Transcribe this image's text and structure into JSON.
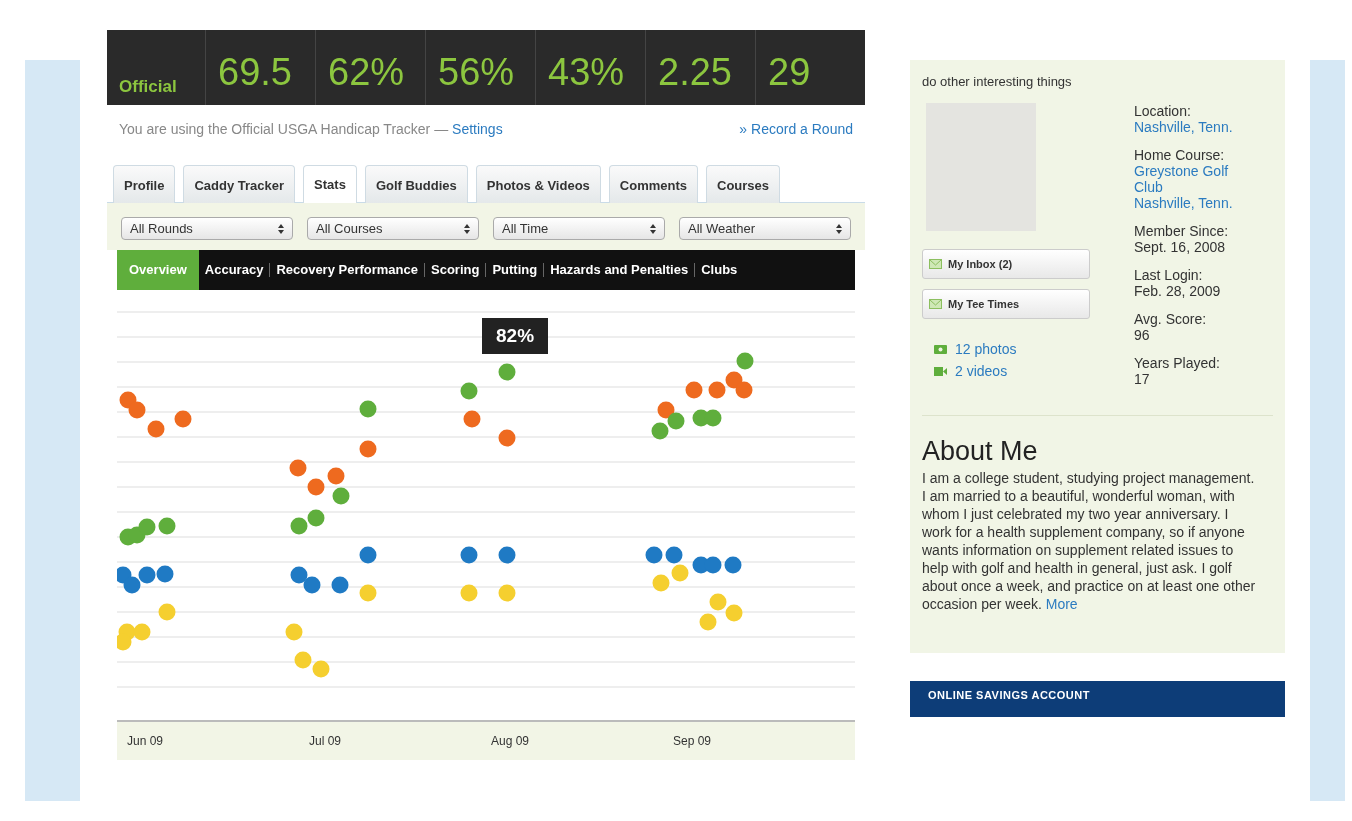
{
  "stats_bar": {
    "label": "Official",
    "values": [
      "69.5",
      "62%",
      "56%",
      "43%",
      "2.25",
      "29"
    ]
  },
  "notice": {
    "text": "You are using the Official USGA Handicap Tracker —",
    "settings_link": "Settings",
    "record_link": "» Record a Round"
  },
  "tabs": [
    {
      "label": "Profile",
      "selected": false
    },
    {
      "label": "Caddy Tracker",
      "selected": false
    },
    {
      "label": "Stats",
      "selected": true
    },
    {
      "label": "Golf Buddies",
      "selected": false
    },
    {
      "label": "Photos & Videos",
      "selected": false
    },
    {
      "label": "Comments",
      "selected": false
    },
    {
      "label": "Courses",
      "selected": false
    }
  ],
  "filters": [
    {
      "value": "All Rounds"
    },
    {
      "value": "All Courses"
    },
    {
      "value": "All Time"
    },
    {
      "value": "All Weather"
    }
  ],
  "subnav": [
    {
      "label": "Overview",
      "selected": true
    },
    {
      "label": "Accuracy",
      "selected": false
    },
    {
      "label": "Recovery Performance",
      "selected": false
    },
    {
      "label": "Scoring",
      "selected": false
    },
    {
      "label": "Putting",
      "selected": false
    },
    {
      "label": "Hazards and Penalties",
      "selected": false
    },
    {
      "label": "Clubs",
      "selected": false
    }
  ],
  "chart": {
    "tooltip": "82%",
    "x_labels": [
      "Jun 09",
      "Jul 09",
      "Aug 09",
      "Sep 09"
    ]
  },
  "sidebar": {
    "intro": "do other interesting things",
    "buttons": [
      {
        "label": "My Inbox (2)"
      },
      {
        "label": "My Tee Times"
      }
    ],
    "media_links": [
      {
        "label": "12 photos",
        "kind": "photo"
      },
      {
        "label": "2 videos",
        "kind": "video"
      }
    ],
    "details": [
      {
        "label": "Location:",
        "kind": "link",
        "values": [
          "Nashville, Tenn."
        ]
      },
      {
        "label": "Home Course:",
        "kind": "link",
        "values": [
          "Greystone Golf Club",
          "Nashville, Tenn."
        ]
      },
      {
        "label": "Member Since:",
        "kind": "text",
        "values": [
          "Sept. 16, 2008"
        ]
      },
      {
        "label": "Last Login:",
        "kind": "text",
        "values": [
          "Feb. 28, 2009"
        ]
      },
      {
        "label": "Avg. Score:",
        "kind": "text",
        "values": [
          "96"
        ]
      },
      {
        "label": "Years Played:",
        "kind": "text",
        "values": [
          "17"
        ]
      }
    ],
    "about": {
      "title": "About Me",
      "text": "I am a college student, studying project management. I am married to a beautiful, wonderful woman, with whom I just celebrated my two year anniversary. I work for a health supplement company, so if anyone wants information on supplement related issues to help with golf and health in general, just ask. I golf about once a week, and practice on at least one other occasion per week.",
      "more_link": "More"
    }
  },
  "ad": {
    "title": "ONLINE SAVINGS ACCOUNT"
  }
}
